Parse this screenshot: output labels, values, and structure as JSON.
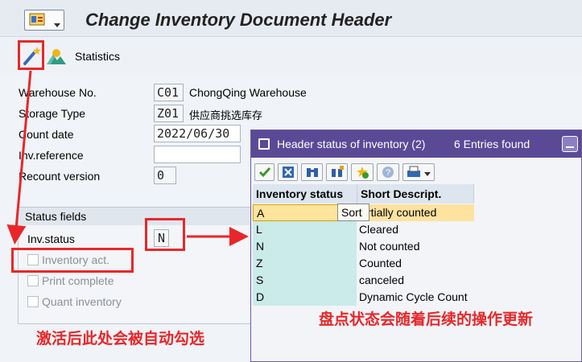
{
  "window": {
    "title": "Change Inventory Document Header"
  },
  "toolbar": {
    "statistics_label": "Statistics"
  },
  "form": {
    "warehouse_no": {
      "label": "Warehouse No.",
      "value": "C01",
      "text": "ChongQing Warehouse"
    },
    "storage_type": {
      "label": "Storage Type",
      "value": "Z01",
      "text": "供应商挑选库存"
    },
    "count_date": {
      "label": "Count date",
      "value": "2022/06/30"
    },
    "inv_reference": {
      "label": "Inv.reference",
      "value": ""
    },
    "recount_version": {
      "label": "Recount version",
      "value": "0"
    }
  },
  "status_fields": {
    "title": "Status fields",
    "inv_status_label": "Inv.status",
    "inv_status_value": "N",
    "checkboxes": [
      {
        "label": "Inventory act.",
        "checked": false
      },
      {
        "label": "Print complete",
        "checked": false
      },
      {
        "label": "Quant inventory",
        "checked": false
      }
    ]
  },
  "popup": {
    "title": "Header status of inventory (2)",
    "entries_found": "6 Entries found",
    "columns": [
      "Inventory status",
      "Short Descript."
    ],
    "rows": [
      {
        "status": "A",
        "description": "Partially counted",
        "visible_description": "rtially counted",
        "selected": true
      },
      {
        "status": "L",
        "description": "Cleared"
      },
      {
        "status": "N",
        "description": "Not counted"
      },
      {
        "status": "Z",
        "description": "Counted"
      },
      {
        "status": "S",
        "description": "canceled"
      },
      {
        "status": "D",
        "description": "Dynamic Cycle Count"
      }
    ],
    "tooltip": "Sort"
  },
  "annotations": {
    "left_note": "激活后此处会被自动勾选",
    "right_note": "盘点状态会随着后续的操作更新",
    "color": "#e8272a"
  }
}
